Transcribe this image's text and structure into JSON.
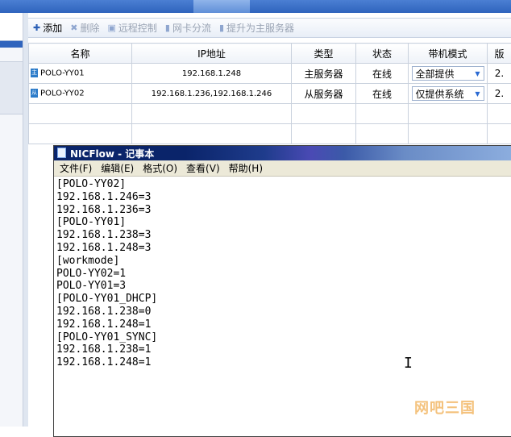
{
  "toolbar": {
    "add": "添加",
    "delete": "删除",
    "remote_control": "远程控制",
    "nic_split": "网卡分流",
    "promote_master": "提升为主服务器"
  },
  "table": {
    "headers": [
      "名称",
      "IP地址",
      "类型",
      "状态",
      "带机模式",
      "版"
    ],
    "rows": [
      {
        "icon": "主",
        "name": "POLO-YY01",
        "ip": "192.168.1.248",
        "type": "主服务器",
        "status": "在线",
        "mode": "全部提供",
        "extra": "2."
      },
      {
        "icon": "从",
        "name": "POLO-YY02",
        "ip": "192.168.1.236,192.168.1.246",
        "type": "从服务器",
        "status": "在线",
        "mode": "仅提供系统",
        "extra": "2."
      }
    ]
  },
  "notepad": {
    "title": "NICFlow - 记事本",
    "menu": [
      "文件(F)",
      "编辑(E)",
      "格式(O)",
      "查看(V)",
      "帮助(H)"
    ],
    "content": "[POLO-YY02]\n192.168.1.246=3\n192.168.1.236=3\n[POLO-YY01]\n192.168.1.238=3\n192.168.1.248=3\n[workmode]\nPOLO-YY02=1\nPOLO-YY01=3\n[POLO-YY01_DHCP]\n192.168.1.238=0\n192.168.1.248=1\n[POLO-YY01_SYNC]\n192.168.1.238=1\n192.168.1.248=1"
  },
  "watermark": "网吧三国",
  "colors": {
    "accent": "#2f64bd",
    "title_bar": "#0a246a",
    "menu_bg": "#ece9d8",
    "disabled": "#9aa4b4"
  }
}
